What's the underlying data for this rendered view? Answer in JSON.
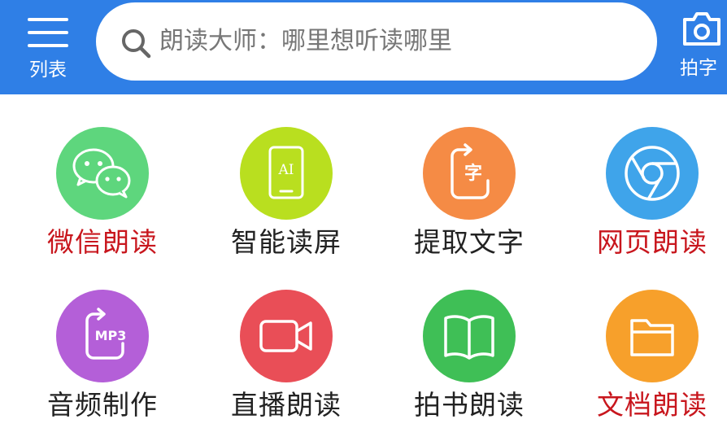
{
  "header": {
    "background": "#2f7fe6",
    "menu": {
      "label": "列表",
      "icon": "hamburger-menu-icon"
    },
    "search": {
      "placeholder": "朗读大师：哪里想听读哪里",
      "icon": "search-icon"
    },
    "camera": {
      "label": "拍字",
      "icon": "camera-icon"
    }
  },
  "grid": {
    "items": [
      {
        "label": "微信朗读",
        "icon": "wechat-icon",
        "color": "#5ed67d",
        "label_color": "#c8161d"
      },
      {
        "label": "智能读屏",
        "icon": "ai-phone-icon",
        "color": "#b9df1f",
        "label_color": "#222222"
      },
      {
        "label": "提取文字",
        "icon": "extract-text-icon",
        "color": "#f58b45",
        "label_color": "#222222"
      },
      {
        "label": "网页朗读",
        "icon": "browser-icon",
        "color": "#3fa4ea",
        "label_color": "#c8161d"
      },
      {
        "label": "音频制作",
        "icon": "mp3-icon",
        "color": "#b45fd8",
        "label_color": "#222222"
      },
      {
        "label": "直播朗读",
        "icon": "video-camera-icon",
        "color": "#e94e57",
        "label_color": "#222222"
      },
      {
        "label": "拍书朗读",
        "icon": "open-book-icon",
        "color": "#3fbf56",
        "label_color": "#222222"
      },
      {
        "label": "文档朗读",
        "icon": "folder-icon",
        "color": "#f7a02b",
        "label_color": "#c8161d"
      }
    ]
  }
}
